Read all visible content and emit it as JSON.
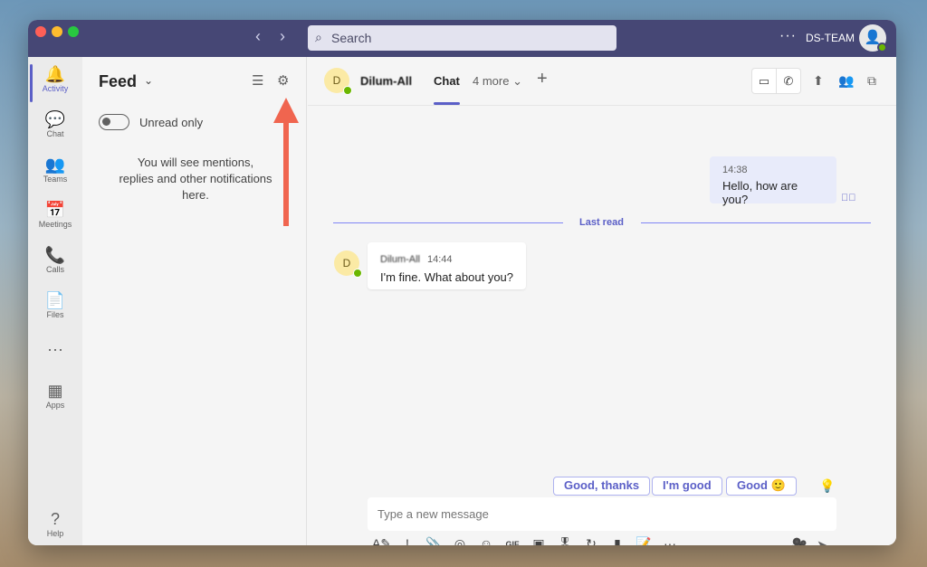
{
  "titlebar": {
    "search_placeholder": "Search",
    "more": "···",
    "team": "DS-TEAM",
    "back": "‹",
    "forward": "›"
  },
  "rail": [
    {
      "label": "Activity",
      "icon": "🔔"
    },
    {
      "label": "Chat",
      "icon": "💬"
    },
    {
      "label": "Teams",
      "icon": "👥"
    },
    {
      "label": "Meetings",
      "icon": "📅"
    },
    {
      "label": "Calls",
      "icon": "📞"
    },
    {
      "label": "Files",
      "icon": "📄"
    },
    {
      "label": "",
      "icon": "···"
    },
    {
      "label": "Apps",
      "icon": "▦"
    },
    {
      "label": "Help",
      "icon": "?"
    }
  ],
  "feed": {
    "title": "Feed",
    "unread_label": "Unread only",
    "empty_text": "You will see mentions, replies and other notifications here."
  },
  "chat": {
    "avatar_initial": "D",
    "name": "Dilum-All",
    "tab": "Chat",
    "more": "4 more ⌄",
    "messages": [
      {
        "time": "14:38",
        "text": "Hello, how are you?"
      },
      {
        "sender": "Dilum-All",
        "time": "14:44",
        "text": "I'm fine. What about you?"
      }
    ],
    "last_read": "Last read",
    "suggestions": [
      "Good, thanks",
      "I'm good",
      "Good 🙂"
    ],
    "compose_placeholder": "Type a new message"
  },
  "colors": {
    "accent": "#5b5fc7",
    "titlebar": "#464775"
  }
}
